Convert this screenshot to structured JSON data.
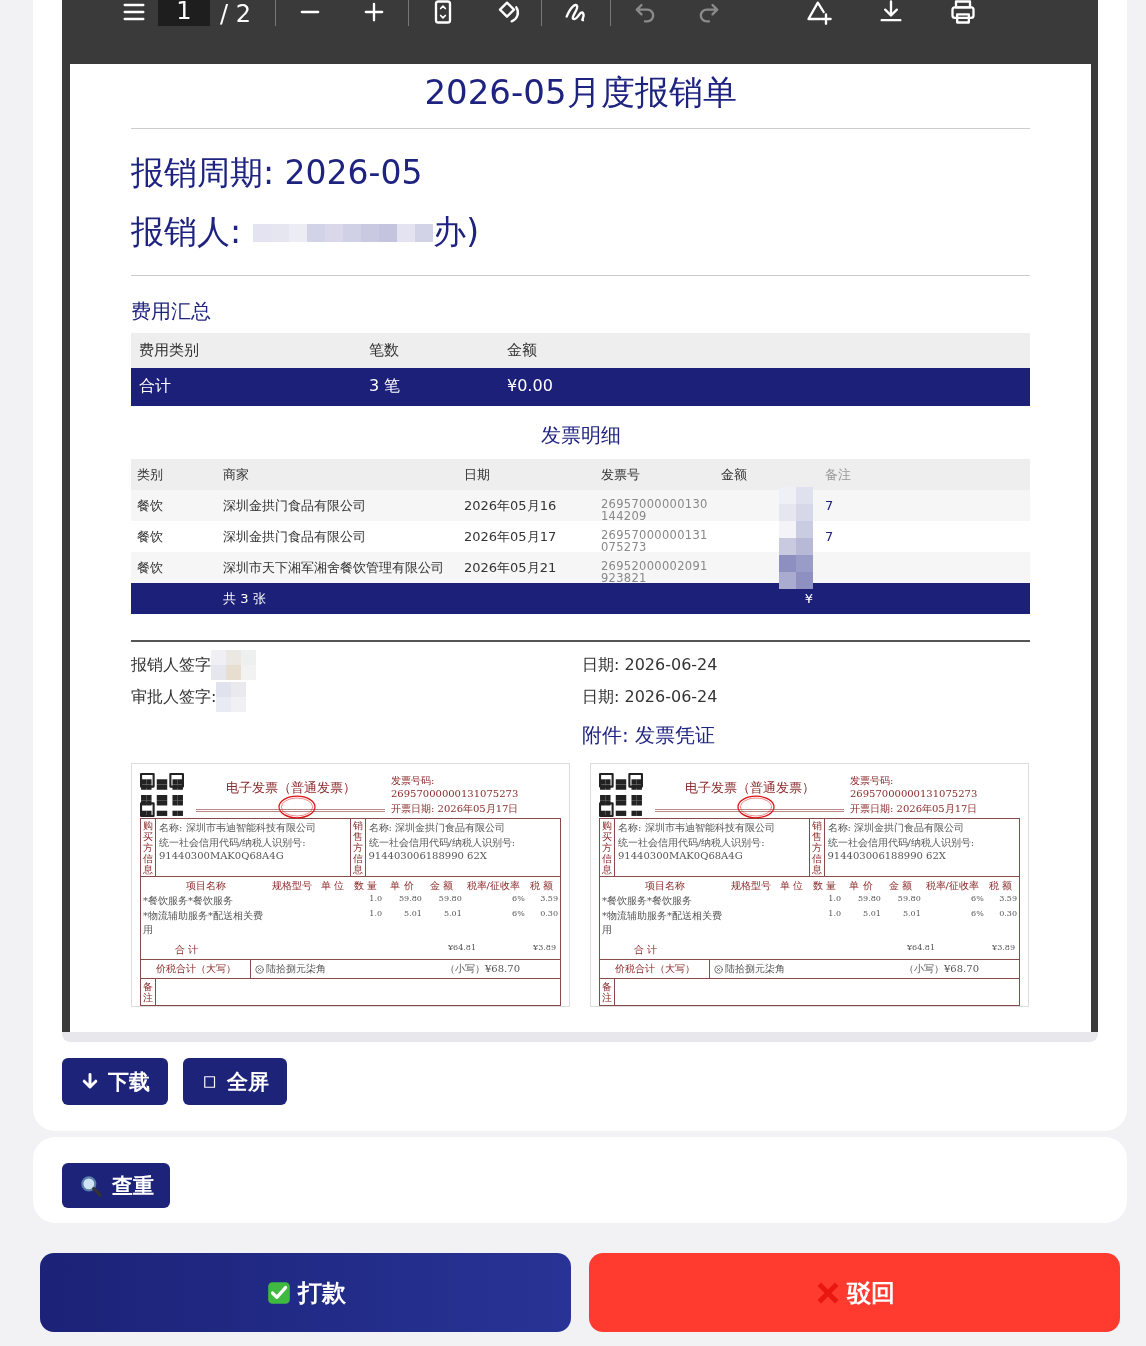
{
  "viewer": {
    "toolbar": {
      "page_input": "1",
      "page_total": "/ 2"
    },
    "document": {
      "title": "2026-05月度报销单",
      "period": "报销周期: 2026-05",
      "claimant_label": "报销人:",
      "claimant_tail": "办)",
      "summary": {
        "title": "费用汇总",
        "columns": [
          "费用类别",
          "笔数",
          "金额"
        ],
        "total": [
          "合计",
          "3 笔",
          "¥0.00"
        ]
      },
      "details": {
        "title": "发票明细",
        "columns": [
          "类别",
          "商家",
          "日期",
          "发票号",
          "金额",
          "备注"
        ],
        "rows": [
          {
            "category": "餐饮",
            "merchant": "深圳金拱门食品有限公司",
            "date": "2026年05月16",
            "invoice_no": "26957000000130144209",
            "remark": "7"
          },
          {
            "category": "餐饮",
            "merchant": "深圳金拱门食品有限公司",
            "date": "2026年05月17",
            "invoice_no": "26957000000131075273",
            "remark": "7"
          },
          {
            "category": "餐饮",
            "merchant": "深圳市天下湘军湘舍餐饮管理有限公司",
            "date": "2026年05月21",
            "invoice_no": "26952000002091923821"
          }
        ],
        "footer": {
          "count": "共 3 张",
          "amount": "¥"
        }
      },
      "signatures": [
        {
          "label": "报销人签字",
          "date": "日期: 2026-06-24"
        },
        {
          "label": "审批人签字:",
          "date": "日期: 2026-06-24"
        }
      ],
      "attachments_title": "附件:  发票凭证",
      "invoices": [
        {
          "title": "电子发票（普通发票）",
          "number": "发票号码: 26957000000131075273",
          "date": "开票日期: 2026年05月17日",
          "buyer_side": "购买方信息",
          "buyer_name": "名称: 深圳市韦迪智能科技有限公司",
          "buyer_tax": "统一社会信用代码/纳税人识别号: 91440300MAK0Q68A4G",
          "seller_side": "销售方信息",
          "seller_name": "名称: 深圳金拱门食品有限公司",
          "seller_tax": "统一社会信用代码/纳税人识别号: 914403006188990 62X",
          "columns": [
            "项目名称",
            "规格型号",
            "单 位",
            "数 量",
            "单 价",
            "金 额",
            "税率/征收率",
            "税 额"
          ],
          "items": [
            {
              "name": "*餐饮服务*餐饮服务",
              "qty": "1.0",
              "price": "59.80",
              "amount": "59.80",
              "rate": "6%",
              "tax": "3.59"
            },
            {
              "name": "*物流辅助服务*配送相关费用",
              "qty": "1.0",
              "price": "5.01",
              "amount": "5.01",
              "rate": "6%",
              "tax": "0.30"
            }
          ],
          "total_label": "合 计",
          "total_amount": "¥64.81",
          "total_tax": "¥3.89",
          "sum_label": "价税合计（大写）",
          "sum_words": "陆拾捌元柒角",
          "sum_small": "（小写）¥68.70",
          "remarks_label": "备注"
        },
        {
          "title": "电子发票（普通发票）",
          "number": "发票号码: 26957000000131075273",
          "date": "开票日期: 2026年05月17日",
          "buyer_side": "购买方信息",
          "buyer_name": "名称: 深圳市韦迪智能科技有限公司",
          "buyer_tax": "统一社会信用代码/纳税人识别号: 91440300MAK0Q68A4G",
          "seller_side": "销售方信息",
          "seller_name": "名称: 深圳金拱门食品有限公司",
          "seller_tax": "统一社会信用代码/纳税人识别号: 914403006188990 62X",
          "columns": [
            "项目名称",
            "规格型号",
            "单 位",
            "数 量",
            "单 价",
            "金 额",
            "税率/征收率",
            "税 额"
          ],
          "items": [
            {
              "name": "*餐饮服务*餐饮服务",
              "qty": "1.0",
              "price": "59.80",
              "amount": "59.80",
              "rate": "6%",
              "tax": "3.59"
            },
            {
              "name": "*物流辅助服务*配送相关费用",
              "qty": "1.0",
              "price": "5.01",
              "amount": "5.01",
              "rate": "6%",
              "tax": "0.30"
            }
          ],
          "total_label": "合 计",
          "total_amount": "¥64.81",
          "total_tax": "¥3.89",
          "sum_label": "价税合计（大写）",
          "sum_words": "陆拾捌元柒角",
          "sum_small": "（小写）¥68.70",
          "remarks_label": "备注"
        }
      ]
    }
  },
  "viewer_actions": [
    {
      "kind": "download",
      "label": "下载"
    },
    {
      "kind": "fullscreen",
      "label": "全屏"
    }
  ],
  "check_action": {
    "kind": "search",
    "label": "查重"
  },
  "bottom_actions": [
    {
      "kind": "pay",
      "label": "打款"
    },
    {
      "kind": "reject",
      "label": "驳回"
    }
  ]
}
